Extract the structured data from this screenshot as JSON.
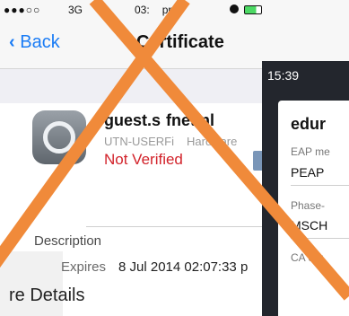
{
  "ios": {
    "status": {
      "carrier": "●●●○○",
      "network": "3G",
      "time": "03:",
      "time_suffix": "pm"
    },
    "nav": {
      "back_label": "Back",
      "title": "Certificate"
    },
    "certificate": {
      "name": "guest.s",
      "name_tail": "fnet.nl",
      "issuer": "UTN-USERFi",
      "issuer_tail": "Hardware",
      "status": "Not Verified"
    },
    "description_label": "Description",
    "expires_label": "Expires",
    "expires_value": "8 Jul 2014 02:07:33 p",
    "more_details": "re Details"
  },
  "android": {
    "time": "15:39",
    "dialog_title": "edur",
    "eap_method_label": "EAP me",
    "eap_method_value": "PEAP",
    "phase2_label": "Phase-",
    "phase2_value": "MSCH",
    "ca_cert_label": "CA cer"
  },
  "colors": {
    "accent_blue": "#1a7cf5",
    "error_red": "#d2222a",
    "overlay_x": "#f08a3a"
  }
}
